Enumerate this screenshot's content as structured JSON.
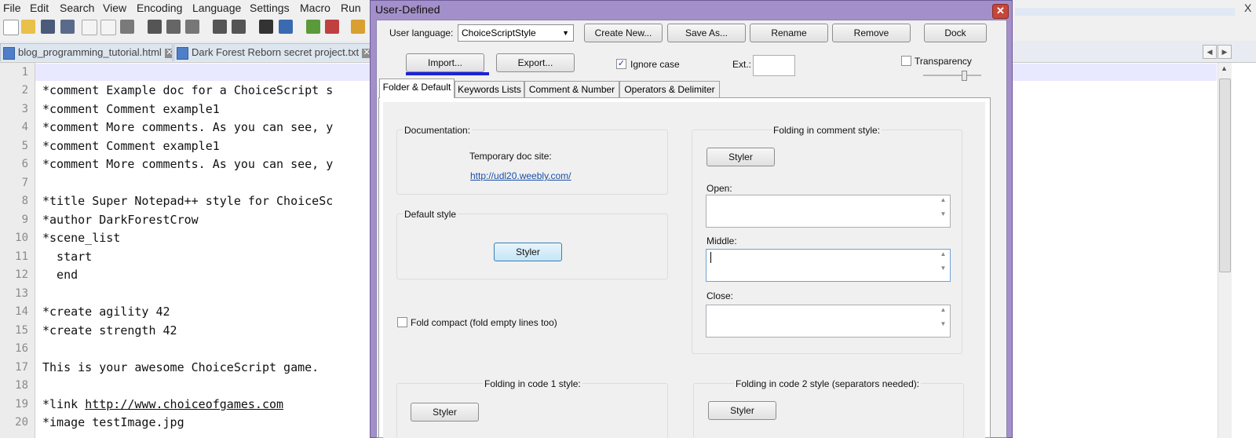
{
  "menubar": {
    "items": [
      "File",
      "Edit",
      "Search",
      "View",
      "Encoding",
      "Language",
      "Settings",
      "Macro",
      "Run"
    ],
    "close_glyph": "X"
  },
  "toolbar": {
    "icons": [
      "new-file-icon",
      "open-folder-icon",
      "save-icon",
      "save-all-icon",
      "close-icon",
      "close-all-icon",
      "print-icon",
      "cut-icon",
      "copy-icon",
      "paste-icon",
      "undo-icon",
      "redo-icon",
      "find-icon",
      "replace-icon",
      "zoom-in-icon",
      "zoom-out-icon",
      "sync-icon"
    ]
  },
  "file_tabs": [
    {
      "label": "blog_programming_tutorial.html"
    },
    {
      "label": "Dark Forest Reborn secret project.txt"
    }
  ],
  "editor": {
    "line_numbers": [
      "1",
      "2",
      "3",
      "4",
      "5",
      "6",
      "7",
      "8",
      "9",
      "10",
      "11",
      "12",
      "13",
      "14",
      "15",
      "16",
      "17",
      "18",
      "19",
      "20"
    ],
    "lines": [
      "",
      "*comment Example doc for a ChoiceScript s",
      "*comment Comment example1",
      "*comment More comments. As you can see, y",
      "*comment Comment example1",
      "*comment More comments. As you can see, y",
      "",
      "*title Super Notepad++ style for ChoiceSc",
      "*author DarkForestCrow",
      "*scene_list",
      "  start",
      "  end",
      "",
      "*create agility 42",
      "*create strength 42",
      "",
      "This is your awesome ChoiceScript game.",
      "",
      "*link ",
      "*image testImage.jpg"
    ],
    "link_url": "http://www.choiceofgames.com"
  },
  "dialog": {
    "title": "User-Defined",
    "close_glyph": "✕",
    "user_language_label": "User language:",
    "user_language_value": "ChoiceScriptStyle",
    "buttons": {
      "create_new": "Create New...",
      "save_as": "Save As...",
      "rename": "Rename",
      "remove": "Remove",
      "dock": "Dock",
      "import": "Import...",
      "export": "Export..."
    },
    "ignore_case": {
      "label": "Ignore case",
      "checked": true
    },
    "ext_label": "Ext.:",
    "transparency": {
      "label": "Transparency",
      "checked": false
    },
    "tabs": [
      "Folder & Default",
      "Keywords Lists",
      "Comment & Number",
      "Operators & Delimiter"
    ],
    "active_tab": "Folder & Default",
    "documentation": {
      "heading": "Documentation:",
      "site_label": "Temporary doc site:",
      "site_url": "http://udl20.weebly.com/"
    },
    "default_style": {
      "heading": "Default style",
      "button": "Styler"
    },
    "fold_compact": {
      "label": "Fold compact (fold empty lines too)",
      "checked": false
    },
    "folding_comment": {
      "heading": "Folding in comment style:",
      "button": "Styler",
      "open_label": "Open:",
      "middle_label": "Middle:",
      "close_label": "Close:"
    },
    "folding_code1": {
      "heading": "Folding in code 1 style:",
      "button": "Styler"
    },
    "folding_code2": {
      "heading": "Folding in code 2 style (separators needed):",
      "button": "Styler"
    }
  },
  "colors": {
    "dialog_frame": "#a38fc9",
    "current_line": "#e8e8ff",
    "link": "#1a4fa8",
    "import_underline": "#1a23d6"
  }
}
